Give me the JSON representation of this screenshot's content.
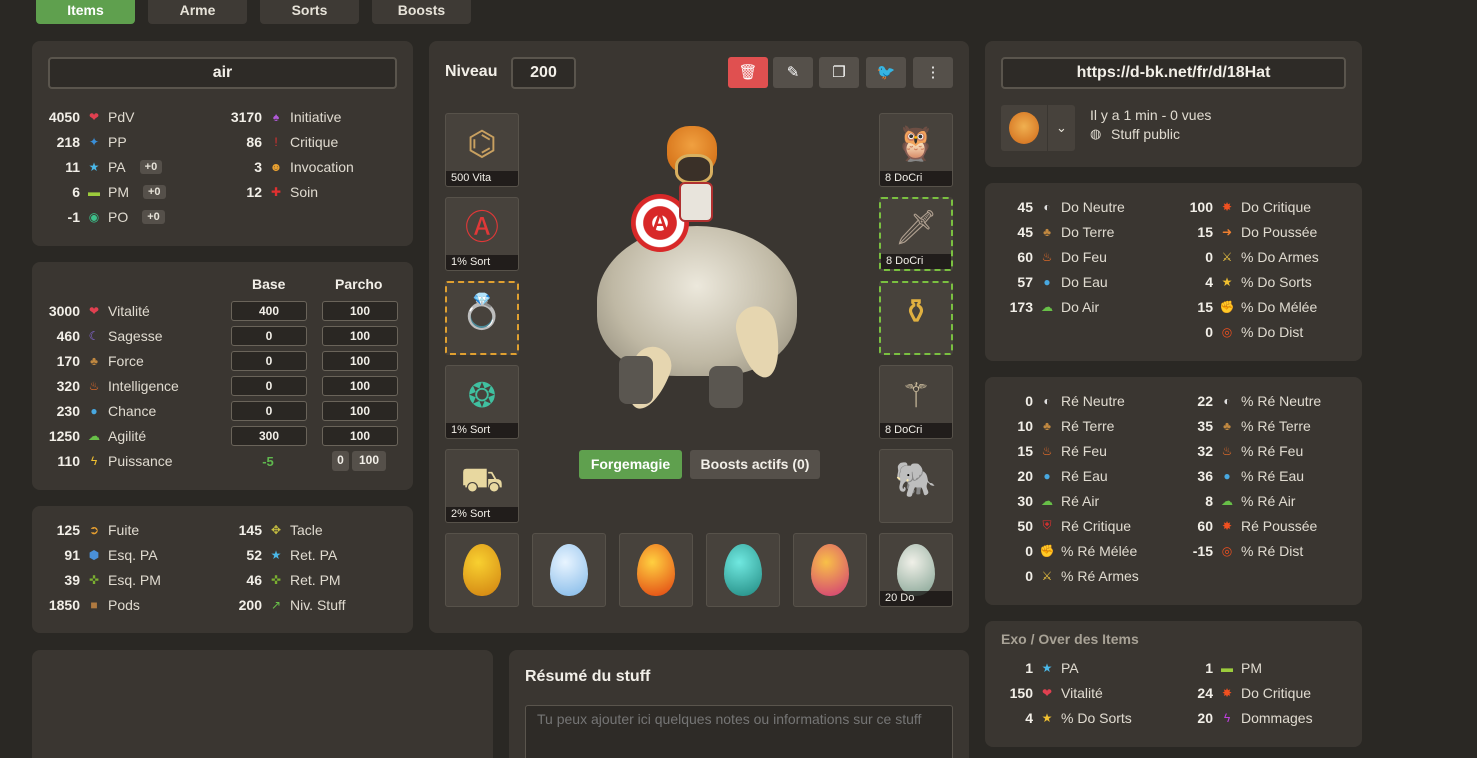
{
  "tabs": [
    "Items",
    "Arme",
    "Sorts",
    "Boosts"
  ],
  "build_name": "air",
  "top_stats": {
    "left": [
      {
        "v": "4050",
        "icon": "heart-icon",
        "g": "❤",
        "c": "#e04050",
        "l": "PdV"
      },
      {
        "v": "218",
        "icon": "pp-icon",
        "g": "✦",
        "c": "#3a8fd8",
        "l": "PP"
      },
      {
        "v": "11",
        "icon": "star-icon",
        "g": "★",
        "c": "#4ab8e8",
        "l": "PA",
        "pill": "+0"
      },
      {
        "v": "6",
        "icon": "boot-icon",
        "g": "▬",
        "c": "#9ccc3c",
        "l": "PM",
        "pill": "+0"
      },
      {
        "v": "-1",
        "icon": "eye-icon",
        "g": "◉",
        "c": "#3cc08a",
        "l": "PO",
        "pill": "+0"
      }
    ],
    "right": [
      {
        "v": "3170",
        "icon": "initiative-icon",
        "g": "♠",
        "c": "#b05ad8",
        "l": "Initiative"
      },
      {
        "v": "86",
        "icon": "exclamation-icon",
        "g": "!",
        "c": "#e03030",
        "l": "Critique"
      },
      {
        "v": "3",
        "icon": "invocation-icon",
        "g": "☻",
        "c": "#e8a030",
        "l": "Invocation"
      },
      {
        "v": "12",
        "icon": "cross-icon",
        "g": "✚",
        "c": "#e03030",
        "l": "Soin"
      }
    ]
  },
  "carac": {
    "h_base": "Base",
    "h_parcho": "Parcho",
    "rows": [
      {
        "v": "3000",
        "icon": "heart-icon",
        "g": "❤",
        "c": "#e04050",
        "l": "Vitalité",
        "base": "400",
        "parcho": "100"
      },
      {
        "v": "460",
        "icon": "moon-icon",
        "g": "☾",
        "c": "#8a6ae0",
        "l": "Sagesse",
        "base": "0",
        "parcho": "100"
      },
      {
        "v": "170",
        "icon": "tree-icon",
        "g": "♣",
        "c": "#c08840",
        "l": "Force",
        "base": "0",
        "parcho": "100"
      },
      {
        "v": "320",
        "icon": "fire-icon",
        "g": "♨",
        "c": "#f07028",
        "l": "Intelligence",
        "base": "0",
        "parcho": "100"
      },
      {
        "v": "230",
        "icon": "drop-icon",
        "g": "●",
        "c": "#48a8e0",
        "l": "Chance",
        "base": "0",
        "parcho": "100"
      },
      {
        "v": "1250",
        "icon": "cloud-icon",
        "g": "☁",
        "c": "#68c048",
        "l": "Agilité",
        "base": "300",
        "parcho": "100"
      }
    ],
    "puissance": {
      "v": "110",
      "icon": "bolt-icon",
      "g": "ϟ",
      "c": "#f0c030",
      "l": "Puissance",
      "base": "-5",
      "a": "0",
      "b": "100"
    }
  },
  "sec_stats": {
    "left": [
      {
        "v": "125",
        "icon": "fuite-icon",
        "g": "➲",
        "c": "#e8a030",
        "l": "Fuite"
      },
      {
        "v": "91",
        "icon": "shield-icon",
        "g": "⬢",
        "c": "#4a90d8",
        "l": "Esq. PA"
      },
      {
        "v": "39",
        "icon": "esq-pm-icon",
        "g": "✜",
        "c": "#7ab030",
        "l": "Esq. PM"
      },
      {
        "v": "1850",
        "icon": "bag-icon",
        "g": "■",
        "c": "#b07a40",
        "l": "Pods"
      }
    ],
    "right": [
      {
        "v": "145",
        "icon": "tacle-icon",
        "g": "✥",
        "c": "#c8c040",
        "l": "Tacle"
      },
      {
        "v": "52",
        "icon": "ret-pa-icon",
        "g": "★",
        "c": "#4ab8e8",
        "l": "Ret. PA"
      },
      {
        "v": "46",
        "icon": "ret-pm-icon",
        "g": "✜",
        "c": "#7ab030",
        "l": "Ret. PM"
      },
      {
        "v": "200",
        "icon": "trend-icon",
        "g": "↗",
        "c": "#68c048",
        "l": "Niv. Stuff"
      }
    ]
  },
  "center": {
    "level_label": "Niveau",
    "level_value": "200",
    "slots_left": [
      {
        "cap": "500 Vita",
        "icon": "amulet-icon",
        "art": "⌬",
        "c": "#c8a060"
      },
      {
        "cap": "1% Sort",
        "icon": "shield-item-icon",
        "art": "Ⓐ",
        "c": "#e03838"
      },
      {
        "cap": "",
        "icon": "ring-icon",
        "art": "💍",
        "c": "#e8d080"
      },
      {
        "cap": "1% Sort",
        "icon": "ring2-icon",
        "art": "❂",
        "c": "#40c0a0"
      },
      {
        "cap": "2% Sort",
        "icon": "boots-icon",
        "art": "⛟",
        "c": "#e8d8a0"
      }
    ],
    "slots_right": [
      {
        "cap": "8 DoCri",
        "icon": "hat-icon",
        "art": "🦉",
        "c": "#c89040"
      },
      {
        "cap": "8 DoCri",
        "icon": "sword-icon",
        "art": "🗡",
        "c": "#b0a090"
      },
      {
        "cap": "",
        "icon": "belt-icon",
        "art": "⚱",
        "c": "#e0b040"
      },
      {
        "cap": "8 DoCri",
        "icon": "cape-icon",
        "art": "⚚",
        "c": "#d0c0a0"
      },
      {
        "cap": "",
        "icon": "pet-icon",
        "art": "🐘",
        "c": "#d0c8b8"
      }
    ],
    "eggs": [
      {
        "icon": "amber-egg-icon",
        "c1": "#f8d030",
        "c2": "#d08010",
        "cap": ""
      },
      {
        "icon": "ice-egg-icon",
        "c1": "#e8f4ff",
        "c2": "#80b8e8",
        "cap": ""
      },
      {
        "icon": "fire-egg-icon",
        "c1": "#ffd040",
        "c2": "#e04010",
        "cap": ""
      },
      {
        "icon": "turquoise-egg-icon",
        "c1": "#70e8e0",
        "c2": "#208880",
        "cap": ""
      },
      {
        "icon": "rainbow-egg-icon",
        "c1": "#f8c048",
        "c2": "#d03878",
        "cap": ""
      },
      {
        "icon": "spotted-egg-icon",
        "c1": "#f0f0e8",
        "c2": "#80a090",
        "cap": "20 Do"
      }
    ],
    "forge_btn": "Forgemagie",
    "boosts_btn": "Boosts actifs (0)"
  },
  "share": {
    "url": "https://d-bk.net/fr/d/18Hat",
    "time": "Il y a 1 min - 0 vues",
    "visibility": "Stuff public"
  },
  "damage": {
    "left": [
      {
        "v": "45",
        "icon": "neutral-icon",
        "g": "◐",
        "c": "#e0e0e0",
        "l": "Do Neutre"
      },
      {
        "v": "45",
        "icon": "earth-icon",
        "g": "♣",
        "c": "#c08840",
        "l": "Do Terre"
      },
      {
        "v": "60",
        "icon": "fire-icon",
        "g": "♨",
        "c": "#f07028",
        "l": "Do Feu"
      },
      {
        "v": "57",
        "icon": "water-icon",
        "g": "●",
        "c": "#48a8e0",
        "l": "Do Eau"
      },
      {
        "v": "173",
        "icon": "air-icon",
        "g": "☁",
        "c": "#68c048",
        "l": "Do Air"
      }
    ],
    "right": [
      {
        "v": "100",
        "icon": "crit-icon",
        "g": "✸",
        "c": "#f05020",
        "l": "Do Critique"
      },
      {
        "v": "15",
        "icon": "push-icon",
        "g": "➜",
        "c": "#f08030",
        "l": "Do Poussée"
      },
      {
        "v": "0",
        "icon": "weapon-icon",
        "g": "⚔",
        "c": "#e8c040",
        "l": "% Do Armes"
      },
      {
        "v": "4",
        "icon": "spell-icon",
        "g": "★",
        "c": "#f0c030",
        "l": "% Do Sorts"
      },
      {
        "v": "15",
        "icon": "melee-icon",
        "g": "✊",
        "c": "#e03030",
        "l": "% Do Mélée"
      },
      {
        "v": "0",
        "icon": "dist-icon",
        "g": "◎",
        "c": "#f05020",
        "l": "% Do Dist"
      }
    ]
  },
  "resist": {
    "left": [
      {
        "v": "0",
        "icon": "neutral-icon",
        "g": "◐",
        "c": "#e0e0e0",
        "l": "Ré Neutre"
      },
      {
        "v": "10",
        "icon": "earth-icon",
        "g": "♣",
        "c": "#c08840",
        "l": "Ré Terre"
      },
      {
        "v": "15",
        "icon": "fire-icon",
        "g": "♨",
        "c": "#f07028",
        "l": "Ré Feu"
      },
      {
        "v": "20",
        "icon": "water-icon",
        "g": "●",
        "c": "#48a8e0",
        "l": "Ré Eau"
      },
      {
        "v": "30",
        "icon": "air-icon",
        "g": "☁",
        "c": "#68c048",
        "l": "Ré Air"
      },
      {
        "v": "50",
        "icon": "crit-shield-icon",
        "g": "⛨",
        "c": "#e03030",
        "l": "Ré Critique"
      },
      {
        "v": "0",
        "icon": "melee-res-icon",
        "g": "✊",
        "c": "#e03030",
        "l": "% Ré Mélée"
      },
      {
        "v": "0",
        "icon": "weapon-res-icon",
        "g": "⚔",
        "c": "#e8c040",
        "l": "% Ré Armes"
      }
    ],
    "right": [
      {
        "v": "22",
        "icon": "neutral-icon",
        "g": "◐",
        "c": "#e0e0e0",
        "l": "% Ré Neutre"
      },
      {
        "v": "35",
        "icon": "earth-icon",
        "g": "♣",
        "c": "#c08840",
        "l": "% Ré Terre"
      },
      {
        "v": "32",
        "icon": "fire-icon",
        "g": "♨",
        "c": "#f07028",
        "l": "% Ré Feu"
      },
      {
        "v": "36",
        "icon": "water-icon",
        "g": "●",
        "c": "#48a8e0",
        "l": "% Ré Eau"
      },
      {
        "v": "8",
        "icon": "air-icon",
        "g": "☁",
        "c": "#68c048",
        "l": "% Ré Air"
      },
      {
        "v": "60",
        "icon": "push-res-icon",
        "g": "✸",
        "c": "#f05020",
        "l": "Ré Poussée"
      },
      {
        "v": "-15",
        "icon": "dist-res-icon",
        "g": "◎",
        "c": "#f05020",
        "l": "% Ré Dist"
      }
    ]
  },
  "exo": {
    "title": "Exo / Over des Items",
    "left": [
      {
        "v": "1",
        "icon": "star-icon",
        "g": "★",
        "c": "#4ab8e8",
        "l": "PA"
      },
      {
        "v": "150",
        "icon": "heart-icon",
        "g": "❤",
        "c": "#e04050",
        "l": "Vitalité"
      },
      {
        "v": "4",
        "icon": "spell-icon",
        "g": "★",
        "c": "#f0c030",
        "l": "% Do Sorts"
      }
    ],
    "right": [
      {
        "v": "1",
        "icon": "boot-icon",
        "g": "▬",
        "c": "#9ccc3c",
        "l": "PM"
      },
      {
        "v": "24",
        "icon": "crit-icon",
        "g": "✸",
        "c": "#f05020",
        "l": "Do Critique"
      },
      {
        "v": "20",
        "icon": "dommages-icon",
        "g": "ϟ",
        "c": "#c040e0",
        "l": "Dommages"
      }
    ]
  },
  "summary": {
    "title": "Résumé du stuff",
    "placeholder": "Tu peux ajouter ici quelques notes ou informations sur ce stuff"
  }
}
